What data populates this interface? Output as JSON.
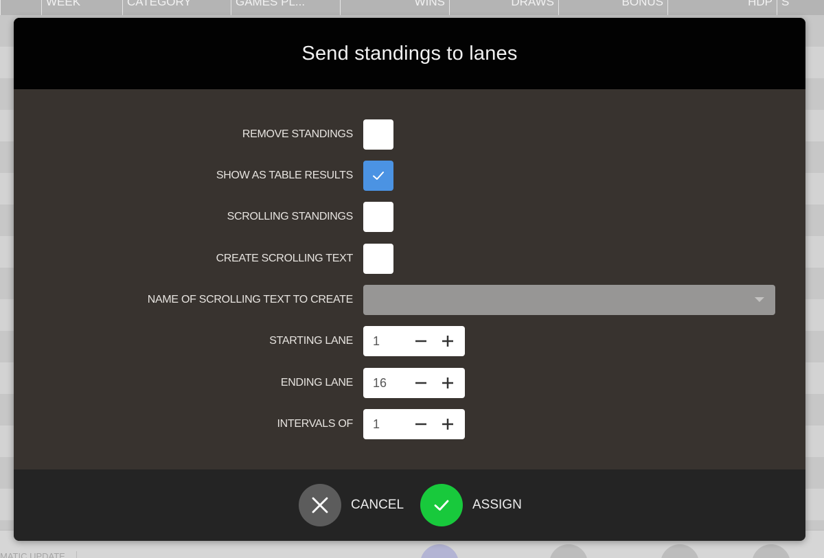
{
  "background": {
    "columns": [
      "WEEK",
      "CATEGORY",
      "GAMES PL...",
      "WINS",
      "DRAWS",
      "BONUS",
      "HDP",
      "S"
    ],
    "footer_label": "MATIC UPDATE"
  },
  "dialog": {
    "title": "Send standings to lanes",
    "fields": {
      "remove_standings": {
        "label": "REMOVE STANDINGS",
        "checked": false
      },
      "show_as_table_results": {
        "label": "SHOW AS TABLE RESULTS",
        "checked": true
      },
      "scrolling_standings": {
        "label": "SCROLLING STANDINGS",
        "checked": false
      },
      "create_scrolling_text": {
        "label": "CREATE SCROLLING TEXT",
        "checked": false
      },
      "scrolling_text_name": {
        "label": "NAME OF SCROLLING TEXT TO CREATE",
        "value": ""
      },
      "starting_lane": {
        "label": "STARTING LANE",
        "value": "1"
      },
      "ending_lane": {
        "label": "ENDING LANE",
        "value": "16"
      },
      "intervals_of": {
        "label": "INTERVALS OF",
        "value": "1"
      }
    },
    "actions": {
      "cancel_label": "CANCEL",
      "assign_label": "ASSIGN"
    }
  },
  "colors": {
    "checkbox_checked": "#4b93e3",
    "assign_green": "#18c93c",
    "cancel_gray": "#5c5c5c",
    "dialog_body": "#38332f"
  }
}
